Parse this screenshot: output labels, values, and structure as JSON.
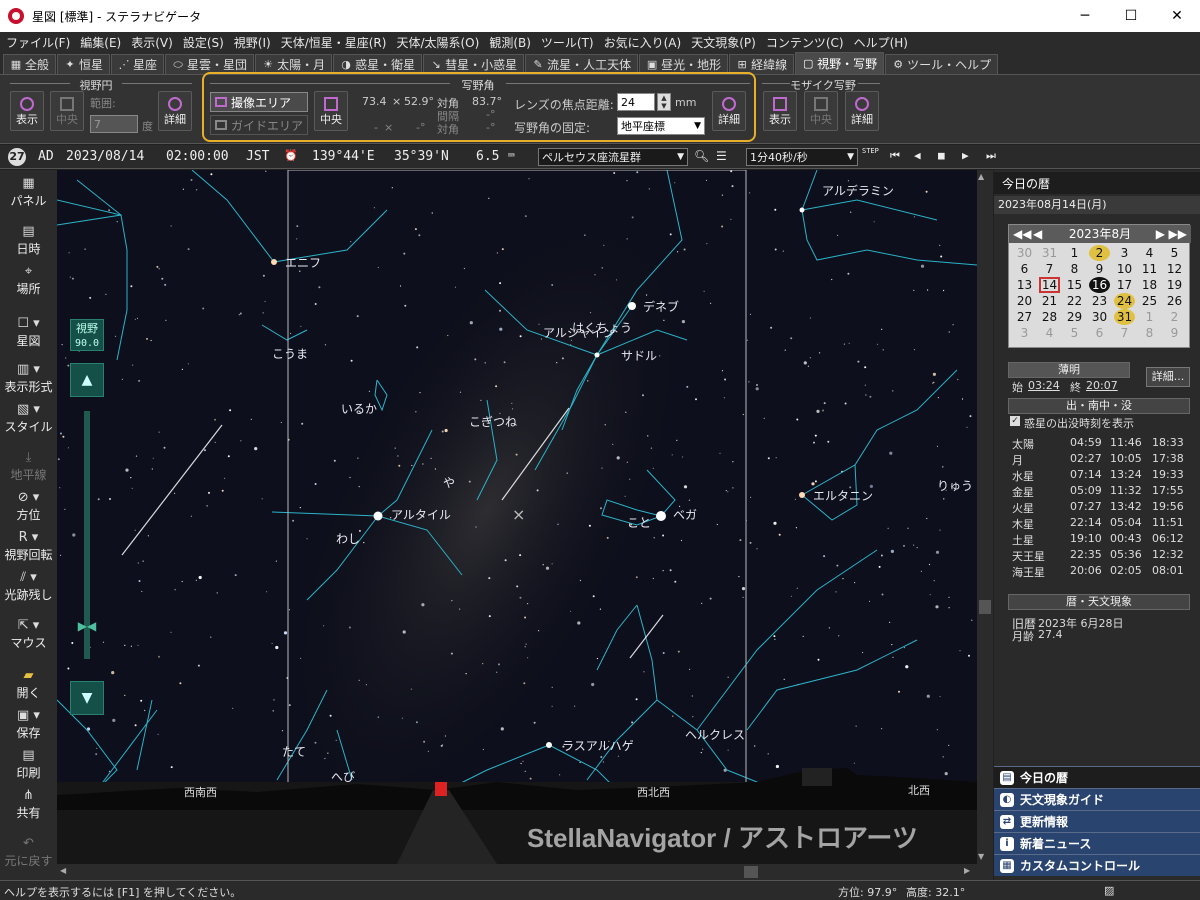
{
  "window": {
    "title": "星図 [標準] - ステラナビゲータ",
    "minimize": "─",
    "maximize": "☐",
    "close": "✕"
  },
  "menu": [
    "ファイル(F)",
    "編集(E)",
    "表示(V)",
    "設定(S)",
    "視野(I)",
    "天体/恒星・星座(R)",
    "天体/太陽系(O)",
    "観測(B)",
    "ツール(T)",
    "お気に入り(A)",
    "天文現象(P)",
    "コンテンツ(C)",
    "ヘルプ(H)"
  ],
  "tabs": [
    {
      "label": "全般",
      "icon": "grid-icon"
    },
    {
      "label": "恒星",
      "icon": "star-icon"
    },
    {
      "label": "星座",
      "icon": "constellation-icon"
    },
    {
      "label": "星雲・星団",
      "icon": "nebula-icon"
    },
    {
      "label": "太陽・月",
      "icon": "sun-icon"
    },
    {
      "label": "惑星・衛星",
      "icon": "planet-icon"
    },
    {
      "label": "彗星・小惑星",
      "icon": "comet-icon"
    },
    {
      "label": "流星・人工天体",
      "icon": "meteor-icon"
    },
    {
      "label": "昼光・地形",
      "icon": "landscape-icon"
    },
    {
      "label": "経緯線",
      "icon": "grid-lines-icon"
    },
    {
      "label": "視野・写野",
      "icon": "field-icon",
      "active": true
    },
    {
      "label": "ツール・ヘルプ",
      "icon": "gear-icon"
    }
  ],
  "ribbon": {
    "fov_circle": {
      "title": "視野円",
      "show": "表示",
      "center": "中央",
      "range_label": "範囲:",
      "range_value": "7",
      "unit": "度",
      "detail": "詳細"
    },
    "photo_field": {
      "title": "写野角",
      "imaging_area": "撮像エリア",
      "guide_area": "ガイドエリア",
      "center": "中央",
      "w": "73.4",
      "x": "×",
      "h": "52.9°",
      "diag_label": "対角",
      "diag_value": "83.7°",
      "w2": "-",
      "x2": "×",
      "h2": "-°",
      "spacing_label": "間隔",
      "spacing_value": "-°",
      "diag2_label": "対角",
      "diag2_value": "-°",
      "focal_label": "レンズの焦点距離:",
      "focal_value": "24",
      "focal_unit": "mm",
      "fix_label": "写野角の固定:",
      "fix_value": "地平座標",
      "detail": "詳細"
    },
    "mosaic": {
      "title": "モザイク写野",
      "show": "表示",
      "center": "中央",
      "detail": "詳細"
    }
  },
  "status": {
    "day": "27",
    "era": "AD",
    "date": "2023/08/14",
    "time": "02:00:00",
    "tz": "JST",
    "lon": "139°44'E",
    "lat": "35°39'N",
    "mag": "6.5",
    "preset": "ペルセウス座流星群",
    "step": "1分40秒/秒",
    "step_label": "STEP"
  },
  "leftbar": [
    {
      "label": "パネル",
      "icon": "panel-icon"
    },
    {
      "label": "日時",
      "icon": "calendar-icon"
    },
    {
      "label": "場所",
      "icon": "location-icon"
    },
    {
      "label": "星図",
      "icon": "chart-icon"
    },
    {
      "label": "表示形式",
      "icon": "display-icon"
    },
    {
      "label": "スタイル",
      "icon": "style-icon"
    },
    {
      "label": "地平線",
      "icon": "horizon-icon",
      "disabled": true
    },
    {
      "label": "方位",
      "icon": "compass-icon"
    },
    {
      "label": "視野回転",
      "icon": "rotate-icon"
    },
    {
      "label": "光跡残し",
      "icon": "trail-icon"
    },
    {
      "label": "マウス",
      "icon": "mouse-icon"
    },
    {
      "label": "開く",
      "icon": "folder-icon"
    },
    {
      "label": "保存",
      "icon": "save-icon"
    },
    {
      "label": "印刷",
      "icon": "print-icon"
    },
    {
      "label": "共有",
      "icon": "share-icon"
    },
    {
      "label": "元に戻す",
      "icon": "undo-icon",
      "disabled": true
    }
  ],
  "fov": {
    "label": "視野",
    "value": "90.0"
  },
  "sky": {
    "labels": [
      "アルデラミン",
      "エニフ",
      "デネブ",
      "アルシャイン",
      "はくちょう",
      "サドル",
      "こうま",
      "いるか",
      "こぎつね",
      "や",
      "アルタイル",
      "わし",
      "こと",
      "ベガ",
      "エルタニン",
      "りゅう",
      "たて",
      "へび",
      "ラスアルハゲ",
      "ヘルクレス"
    ],
    "directions": [
      "西南西",
      "西北西",
      "北西"
    ],
    "watermark": "StellaNavigator / アストロアーツ"
  },
  "panel": {
    "title": "今日の暦",
    "date": "2023年08月14日(月)",
    "calendar": {
      "month": "2023年8月",
      "prev": "◀◀",
      "prev1": "◀",
      "next1": "▶",
      "next": "▶▶",
      "days": [
        [
          "30",
          "31",
          "1",
          "2",
          "3",
          "4",
          "5"
        ],
        [
          "6",
          "7",
          "8",
          "9",
          "10",
          "11",
          "12"
        ],
        [
          "13",
          "14",
          "15",
          "16",
          "17",
          "18",
          "19"
        ],
        [
          "20",
          "21",
          "22",
          "23",
          "24",
          "25",
          "26"
        ],
        [
          "27",
          "28",
          "29",
          "30",
          "31",
          "1",
          "2"
        ],
        [
          "3",
          "4",
          "5",
          "6",
          "7",
          "8",
          "9"
        ]
      ]
    },
    "twilight": {
      "title": "薄明",
      "start_label": "始",
      "start": "03:24",
      "end_label": "終",
      "end": "20:07",
      "detail": "詳細..."
    },
    "rise_set": {
      "title": "出・南中・没",
      "checkbox": "惑星の出没時刻を表示",
      "rows": [
        [
          "太陽",
          "04:59",
          "11:46",
          "18:33"
        ],
        [
          "月",
          "02:27",
          "10:05",
          "17:38"
        ],
        [
          "水星",
          "07:14",
          "13:24",
          "19:33"
        ],
        [
          "金星",
          "05:09",
          "11:32",
          "17:55"
        ],
        [
          "火星",
          "07:27",
          "13:42",
          "19:56"
        ],
        [
          "木星",
          "22:14",
          "05:04",
          "11:51"
        ],
        [
          "土星",
          "19:10",
          "00:43",
          "06:12"
        ],
        [
          "天王星",
          "22:35",
          "05:36",
          "12:32"
        ],
        [
          "海王星",
          "20:06",
          "02:05",
          "08:01"
        ]
      ]
    },
    "events": {
      "title": "暦・天文現象",
      "lunar_label": "旧暦",
      "lunar": "2023年 6月28日",
      "age_label": "月齢",
      "age": "27.4"
    },
    "nav": [
      "今日の暦",
      "天文現象ガイド",
      "更新情報",
      "新着ニュース",
      "カスタムコントロール"
    ]
  },
  "statusbar": {
    "help": "ヘルプを表示するには [F1] を押してください。",
    "azimuth": "方位:  97.9°",
    "altitude": "高度:  32.1°"
  }
}
